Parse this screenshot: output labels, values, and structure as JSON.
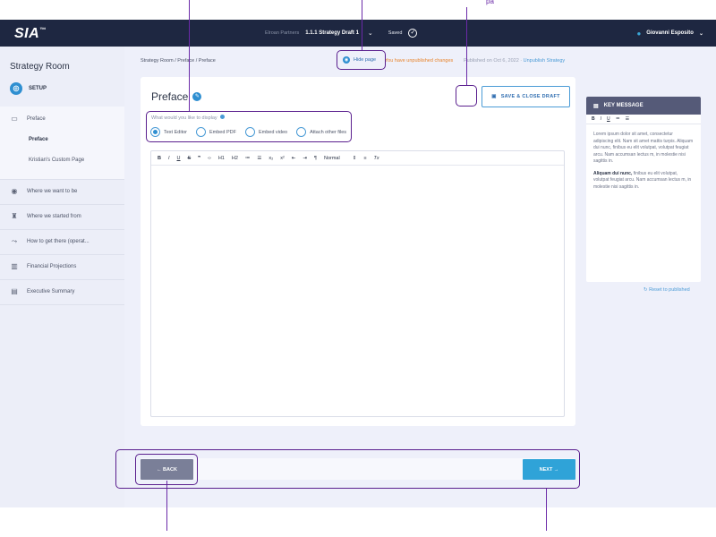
{
  "topbar": {
    "logo": "SIA",
    "company": "Elroan Partners",
    "draft": "1.1.1 Strategy Draft 1",
    "saved": "Saved",
    "user": "Giovanni Esposito"
  },
  "sidebar": {
    "title": "Strategy Room",
    "setup": "SETUP",
    "items": [
      {
        "label": "Preface",
        "icon": "document-icon"
      },
      {
        "label": "Where we want to be",
        "icon": "target-icon"
      },
      {
        "label": "Where we started from",
        "icon": "rocket-icon"
      },
      {
        "label": "How to get there (operat...",
        "icon": "route-icon"
      },
      {
        "label": "Financial Projections",
        "icon": "chart-icon"
      },
      {
        "label": "Executive Summary",
        "icon": "summary-icon"
      }
    ],
    "sub_items": [
      "Preface",
      "Kristian's Custom Page"
    ]
  },
  "breadcrumb": "Strategy Room / Preface / Preface",
  "status": {
    "hide_page": "Hide page",
    "unpublished": "You have unpublished changes",
    "published": "Published on Oct 6, 2022 ·",
    "unpublish_link": "Unpublish Strategy"
  },
  "card": {
    "title": "Preface",
    "save_close": "SAVE & CLOSE DRAFT",
    "display_question": "What would you like to display",
    "options": [
      "Text Editor",
      "Embed PDF",
      "Embed video",
      "Attach other files"
    ],
    "selected_option": "Text Editor",
    "toolbar": [
      "B",
      "I",
      "U",
      "S",
      "❞",
      "‹›",
      "H1",
      "H2",
      "≔",
      "☰",
      "x₂",
      "x²",
      "⇤",
      "⇥",
      "¶",
      "Normal",
      "⇕",
      "≡",
      "Tx"
    ]
  },
  "key_message": {
    "title": "KEY MESSAGE",
    "tools": [
      "B",
      "I",
      "U",
      "≔",
      "☰"
    ],
    "p1": "Lorem ipsum dolor sit amet, consectetur adipiscing elit. Nam sit amet mattis turpis. Aliquam dui nunc, finibus eu elit volutpat, volutpat feugiat arcu. Nam accumsan lectus m, in molestie nisi sagittis in.",
    "p2_bold": "Aliquam dui nunc,",
    "p2": " finibus eu elit volutpat, volutpat feugiat arcu. Nam accumsan lectus m, in molestie nisi sagittis in.",
    "reset": "Reset to published"
  },
  "footer": {
    "back": "← BACK",
    "next": "NEXT →"
  },
  "annotation_label": "pa"
}
